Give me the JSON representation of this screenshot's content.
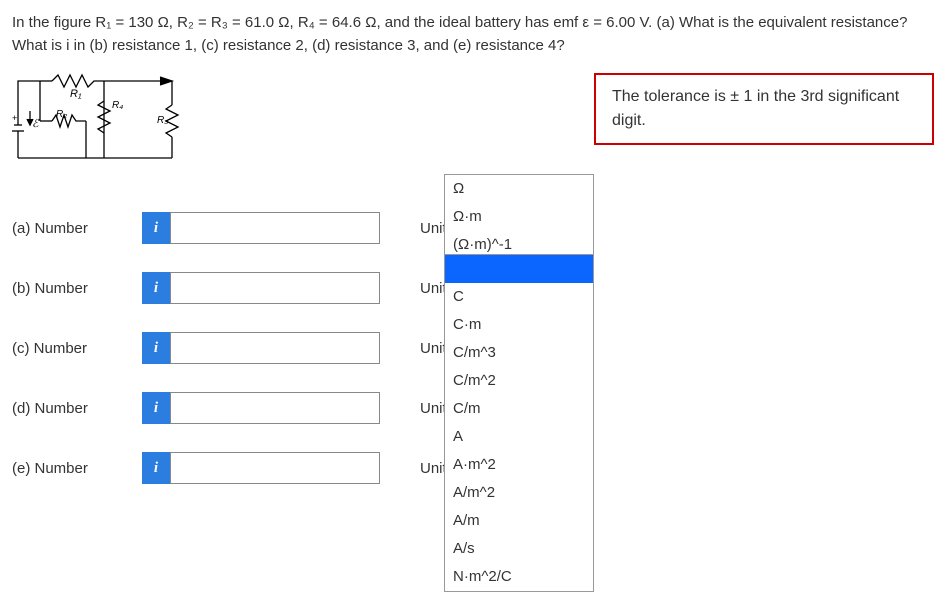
{
  "question": {
    "line1": "In the figure R₁ = 130 Ω, R₂ = R₃ = 61.0 Ω, R₄ = 64.6 Ω, and the ideal battery has emf ε = 6.00 V. (a) What is the equivalent resistance?",
    "line2": "What is i in (b) resistance 1, (c) resistance 2, (d) resistance 3, and (e) resistance 4?"
  },
  "tolerance": "The tolerance is ± 1 in the 3rd significant digit.",
  "circuit_labels": {
    "r1": "R₁",
    "r2": "R₂",
    "r3": "R₃",
    "r4": "R₄",
    "emf": "ℰ"
  },
  "parts": {
    "a": {
      "label": "(a)   Number",
      "units_label": "Units"
    },
    "b": {
      "label": "(b)   Number",
      "units_label": "Units"
    },
    "c": {
      "label": "(c)   Number",
      "units_label": "Units"
    },
    "d": {
      "label": "(d)   Number",
      "units_label": "Units"
    },
    "e": {
      "label": "(e)   Number",
      "units_label": "Units"
    }
  },
  "info_badge": "i",
  "dropdown_a": {
    "options": [
      "Ω",
      "Ω·m",
      "(Ω·m)^-1"
    ]
  },
  "dropdown_b": {
    "options": [
      "",
      "C",
      "C·m",
      "C/m^3",
      "C/m^2",
      "C/m",
      "A",
      "A·m^2",
      "A/m^2",
      "A/m",
      "A/s",
      "N·m^2/C"
    ]
  }
}
